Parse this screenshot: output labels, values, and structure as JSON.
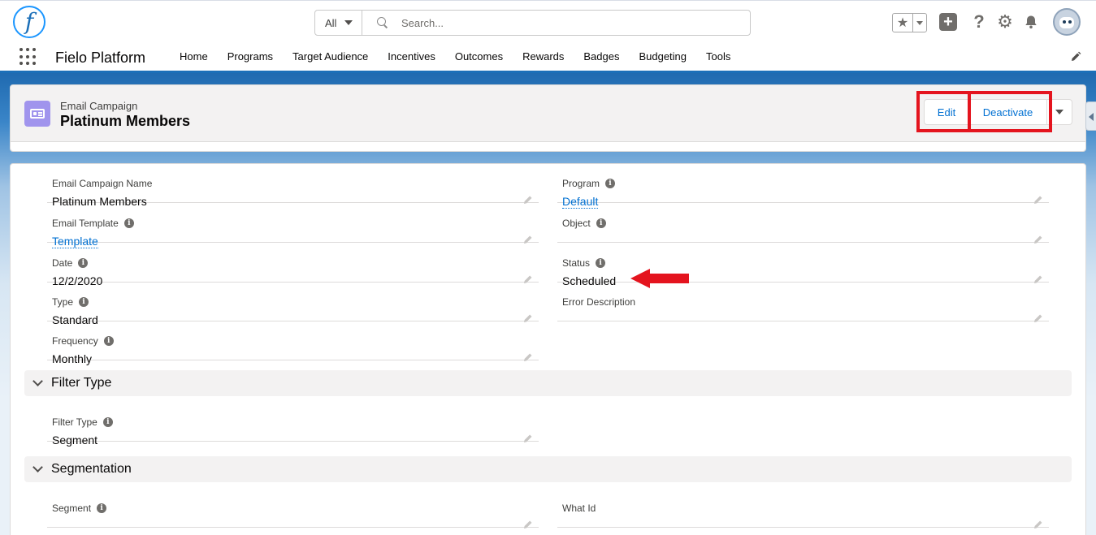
{
  "header": {
    "logo_letter": "f",
    "search": {
      "scope": "All",
      "placeholder": "Search..."
    },
    "icons": [
      "favorites-star-icon",
      "add-icon",
      "help-icon",
      "setup-gear-icon",
      "notification-bell-icon",
      "avatar"
    ]
  },
  "nav": {
    "app_name": "Fielo Platform",
    "items": [
      "Home",
      "Programs",
      "Target Audience",
      "Incentives",
      "Outcomes",
      "Rewards",
      "Badges",
      "Budgeting",
      "Tools"
    ]
  },
  "record": {
    "type": "Email Campaign",
    "name": "Platinum Members",
    "buttons": {
      "edit": "Edit",
      "deactivate": "Deactivate"
    }
  },
  "details": {
    "left": [
      {
        "label": "Email Campaign Name",
        "value": "Platinum Members",
        "info": false,
        "link": false
      },
      {
        "label": "Email Template",
        "value": "Template",
        "info": true,
        "link": true
      },
      {
        "label": "Date",
        "value": "12/2/2020",
        "info": true,
        "link": false
      },
      {
        "label": "Type",
        "value": "Standard",
        "info": true,
        "link": false
      },
      {
        "label": "Frequency",
        "value": "Monthly",
        "info": true,
        "link": false
      }
    ],
    "right": [
      {
        "label": "Program",
        "value": "Default",
        "info": true,
        "link": true
      },
      {
        "label": "Object",
        "value": "",
        "info": true,
        "link": false
      },
      {
        "label": "Status",
        "value": "Scheduled",
        "info": true,
        "link": false
      },
      {
        "label": "Error Description",
        "value": "",
        "info": false,
        "link": false
      }
    ]
  },
  "sections": {
    "filter_type": {
      "title": "Filter Type",
      "field": {
        "label": "Filter Type",
        "value": "Segment"
      }
    },
    "segmentation": {
      "title": "Segmentation",
      "segment": {
        "label": "Segment",
        "value": ""
      },
      "what_id": {
        "label": "What Id",
        "value": ""
      }
    }
  },
  "colors": {
    "brand": "#1b6fb8",
    "link": "#0070d2",
    "highlight": "#e4141e",
    "record_icon": "#a094ed"
  }
}
